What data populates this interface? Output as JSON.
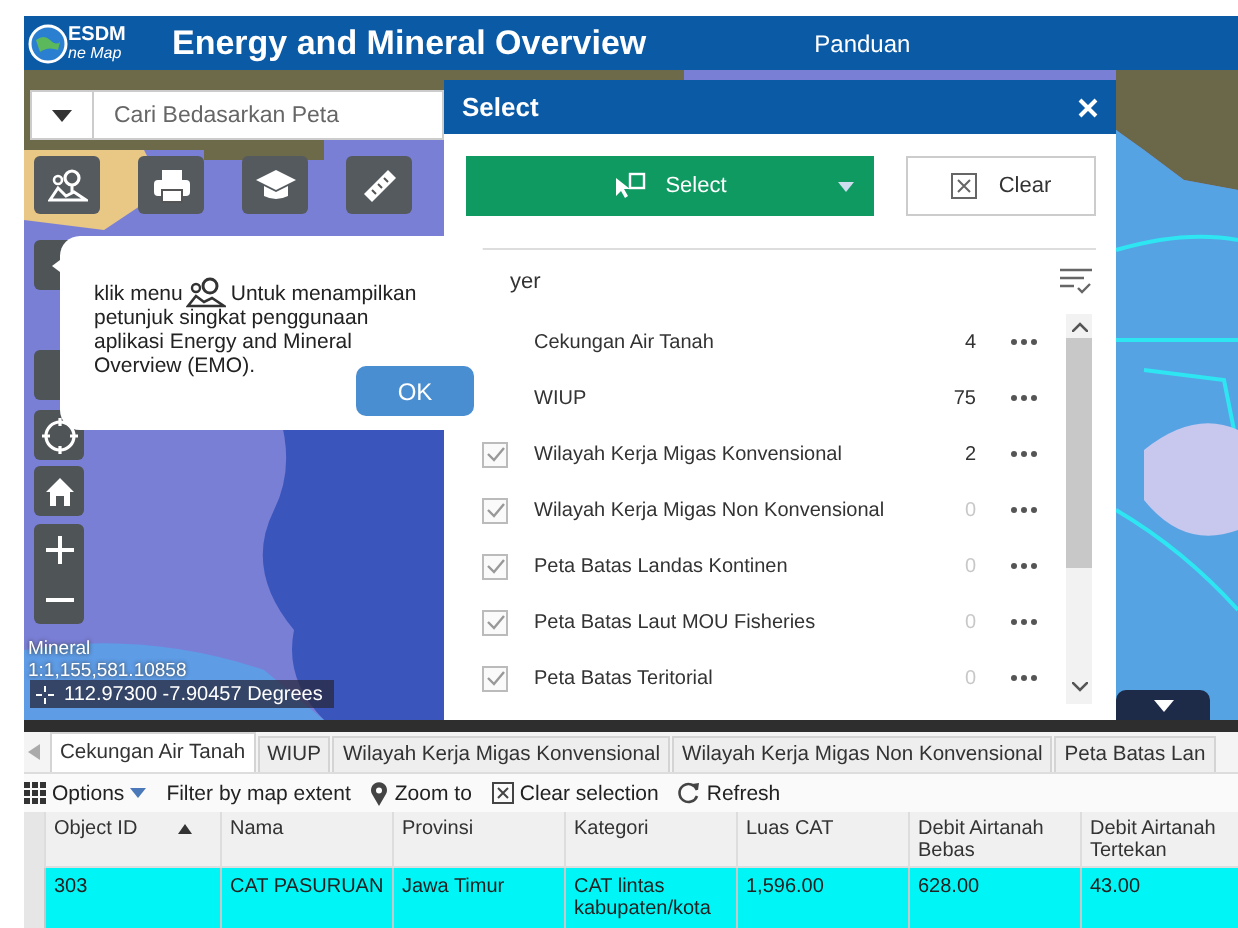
{
  "header": {
    "logo_top": "ESDM",
    "logo_bottom": "ne Map",
    "title": "Energy and Mineral Overview",
    "link": "Panduan"
  },
  "search": {
    "placeholder": "Cari Bedasarkan Peta"
  },
  "map": {
    "scale_label": "Mineral",
    "scale": "1:1,155,581.10858",
    "coordinates": "112.97300 -7.90457 Degrees"
  },
  "popup": {
    "text_before": "klik menu",
    "text_after": "Untuk menampilkan",
    "text_rest": "petunjuk singkat penggunaan aplikasi Energy and Mineral Overview (EMO).",
    "button": "OK"
  },
  "select_panel": {
    "title": "Select",
    "select_button": "Select",
    "clear_button": "Clear",
    "layer_heading": "yer",
    "layers": [
      {
        "name": "Cekungan Air Tanah",
        "count": "4",
        "disabled": false
      },
      {
        "name": "WIUP",
        "count": "75",
        "disabled": false
      },
      {
        "name": "Wilayah Kerja Migas Konvensional",
        "count": "2",
        "checked": true,
        "disabled": false
      },
      {
        "name": "Wilayah Kerja Migas Non Konvensional",
        "count": "0",
        "checked": true,
        "disabled": true
      },
      {
        "name": "Peta Batas Landas Kontinen",
        "count": "0",
        "checked": true,
        "disabled": true
      },
      {
        "name": "Peta Batas Laut MOU Fisheries",
        "count": "0",
        "checked": true,
        "disabled": true
      },
      {
        "name": "Peta Batas Teritorial",
        "count": "0",
        "checked": true,
        "disabled": true
      }
    ]
  },
  "table": {
    "tabs": [
      {
        "label": "Cekungan Air Tanah",
        "selected": true
      },
      {
        "label": "WIUP",
        "selected": false
      },
      {
        "label": "Wilayah Kerja Migas Konvensional",
        "selected": false
      },
      {
        "label": "Wilayah Kerja Migas Non Konvensional",
        "selected": false
      },
      {
        "label": "Peta Batas Lan",
        "selected": false
      }
    ],
    "toolbar": [
      {
        "label": "Options",
        "kind": "options"
      },
      {
        "label": "Filter by map extent",
        "kind": "filter"
      },
      {
        "label": "Zoom to",
        "kind": "zoom"
      },
      {
        "label": "Clear selection",
        "kind": "clear"
      },
      {
        "label": "Refresh",
        "kind": "refresh"
      }
    ],
    "columns": [
      {
        "label": "Object ID",
        "sorted": true
      },
      {
        "label": "Nama",
        "sorted": false
      },
      {
        "label": "Provinsi",
        "sorted": false
      },
      {
        "label": "Kategori",
        "sorted": false
      },
      {
        "label": "Luas CAT",
        "sorted": false
      },
      {
        "label": "Debit Airtanah Bebas",
        "sorted": false
      },
      {
        "label": "Debit Airtanah Tertekan",
        "sorted": false
      }
    ],
    "rows": [
      {
        "selected": true,
        "cells": [
          "303",
          "CAT PASURUAN",
          "Jawa Timur",
          "CAT lintas kabupaten/kota",
          "1,596.00",
          "628.00",
          "43.00"
        ]
      }
    ]
  }
}
